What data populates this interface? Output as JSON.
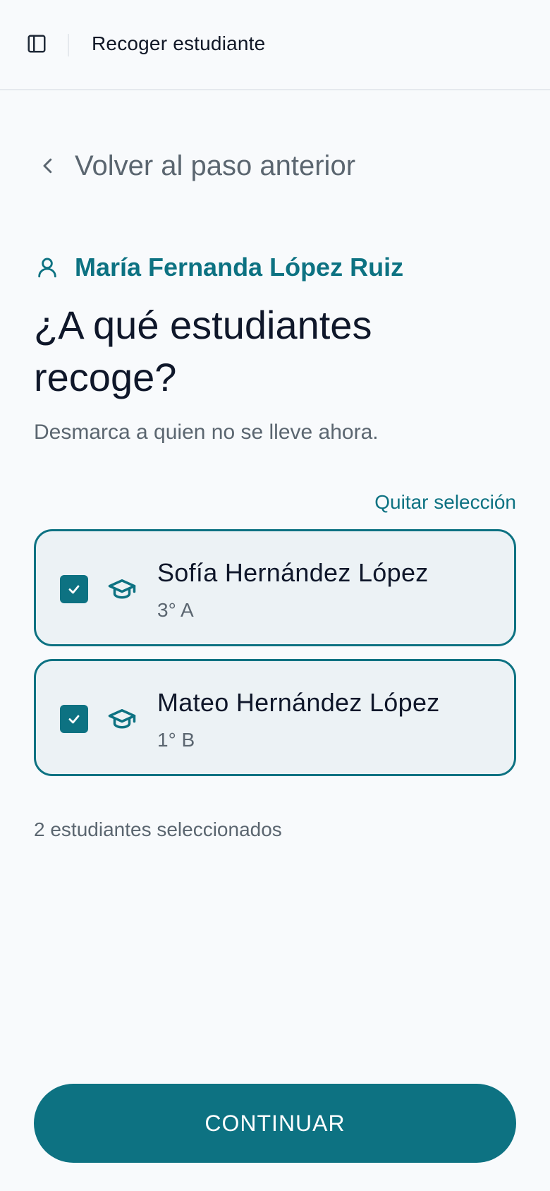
{
  "header": {
    "title": "Recoger estudiante",
    "sidebar_icon": "sidebar-panel-icon"
  },
  "back": {
    "label": "Volver al paso anterior",
    "icon": "chevron-left-icon"
  },
  "guardian": {
    "name": "María Fernanda López Ruiz",
    "icon": "user-icon"
  },
  "headline": "¿A qué estudiantes recoge?",
  "subtitle": "Desmarca a quien no se lleve ahora.",
  "clear_selection_label": "Quitar selección",
  "students": [
    {
      "name": "Sofía Hernández López",
      "grade": "3° A",
      "checked": true,
      "icon": "graduation-cap-icon"
    },
    {
      "name": "Mateo Hernández López",
      "grade": "1° B",
      "checked": true,
      "icon": "graduation-cap-icon"
    }
  ],
  "selected_count_text": "2 estudiantes seleccionados",
  "continue_label": "CONTINUAR",
  "colors": {
    "accent": "#0d7282",
    "card_bg": "#ecf2f5",
    "background": "#f8fafc",
    "muted_text": "#5b6670"
  }
}
